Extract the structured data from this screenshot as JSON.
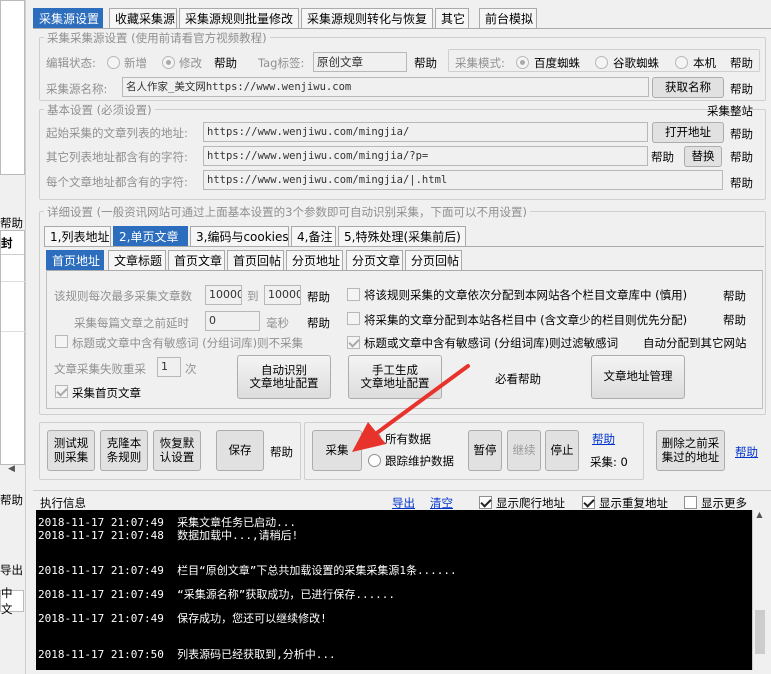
{
  "main_tabs": [
    "采集源设置",
    "收藏采集源",
    "采集源规则批量修改",
    "采集源规则转化与恢复",
    "其它",
    "前台模拟"
  ],
  "left_panel": {
    "help": "帮助",
    "fen": "封",
    "help2": "帮助",
    "export": "导出",
    "chinese": "中文"
  },
  "source_settings": {
    "group_title": "采集采集源设置 (使用前请看官方视频教程)",
    "edit_state_label": "编辑状态:",
    "radio_new": "新增",
    "radio_edit": "修改",
    "help": "帮助",
    "tag_label": "Tag标签:",
    "tag_value": "原创文章",
    "mode_label": "采集模式:",
    "mode_baidu": "百度蜘蛛",
    "mode_google": "谷歌蜘蛛",
    "mode_local": "本机",
    "name_label": "采集源名称:",
    "name_value": "名人作家_美文网https://www.wenjiwu.com",
    "get_name_btn": "获取名称"
  },
  "basic_settings": {
    "group_title": "基本设置 (必须设置)",
    "collect_station": "采集整站",
    "start_url_label": "起始采集的文章列表的地址:",
    "start_url_value": "https://www.wenjiwu.com/mingjia/",
    "open_url_btn": "打开地址",
    "list_chars_label": "其它列表地址都含有的字符:",
    "list_chars_value": "https://www.wenjiwu.com/mingjia/?p=",
    "replace_btn": "替换",
    "article_chars_label": "每个文章地址都含有的字符:",
    "article_chars_value": "https://www.wenjiwu.com/mingjia/|.html",
    "help": "帮助"
  },
  "detail_settings": {
    "group_title": "详细设置 (一般资讯网站可通过上面基本设置的3个参数即可自动识别采集，下面可以不用设置)",
    "tabs": [
      "1,列表地址",
      "2,单页文章",
      "3,编码与cookies",
      "4,备注",
      "5,特殊处理(采集前后)"
    ],
    "subtabs": [
      "首页地址",
      "文章标题",
      "首页文章",
      "首页回帖",
      "分页地址",
      "分页文章",
      "分页回帖"
    ],
    "max_articles_label": "该规则每次最多采集文章数",
    "max_from": "10000",
    "to": "到",
    "max_to": "10000",
    "help": "帮助",
    "delay_label": "采集每篇文章之前延时",
    "delay_value": "0",
    "ms": "毫秒",
    "sensitive_skip": "标题或文章中含有敏感词 (分组词库)则不采集",
    "retry_label": "文章采集失败重采",
    "retry_value": "1",
    "times": "次",
    "collect_first": "采集首页文章",
    "distribute_label": "将该规则采集的文章依次分配到本网站各个栏目文章库中 (慎用)",
    "distribute_least": "将采集的文章分配到本站各栏目中 (含文章少的栏目则优先分配)",
    "sensitive_filter": "标题或文章中含有敏感词 (分组词库)则过滤敏感词",
    "auto_other": "自动分配到其它网站",
    "auto_detect_btn": "自动识别\n文章地址配置",
    "manual_btn": "手工生成\n文章地址配置",
    "must_help": "必看帮助",
    "addr_manage_btn": "文章地址管理"
  },
  "actions": {
    "test_btn": "测试规\n则采集",
    "clone_btn": "克隆本\n条规则",
    "restore_btn": "恢复默\n认设置",
    "save_btn": "保存",
    "help": "帮助",
    "collect_btn": "采集",
    "all_data": "所有数据",
    "track_data": "跟踪维护数据",
    "pause_btn": "暂停",
    "continue_btn": "继续",
    "stop_btn": "停止",
    "help_link": "帮助",
    "collect_count": "采集: 0",
    "delete_btn": "删除之前采\n集过的地址",
    "help_link2": "帮助"
  },
  "log_header": {
    "title": "执行信息",
    "export": "导出",
    "clear": "清空",
    "show_crawl": "显示爬行地址",
    "show_dup": "显示重复地址",
    "show_more": "显示更多"
  },
  "log_lines": [
    "2018-11-17 21:07:49  采集文章任务已启动...",
    "2018-11-17 21:07:48  数据加载中...,请稍后!",
    "2018-11-17 21:07:49  栏目“原创文章”下总共加载设置的采集采集源1条......",
    "2018-11-17 21:07:49  “采集源名称”获取成功，已进行保存......",
    "2018-11-17 21:07:49  保存成功，您还可以继续修改!",
    "2018-11-17 21:07:50  列表源码已经获取到,分析中..."
  ],
  "colors": {
    "tab_selected": "#2c6dbd",
    "arrow": "#e8322c",
    "log_bg": "#000000"
  }
}
